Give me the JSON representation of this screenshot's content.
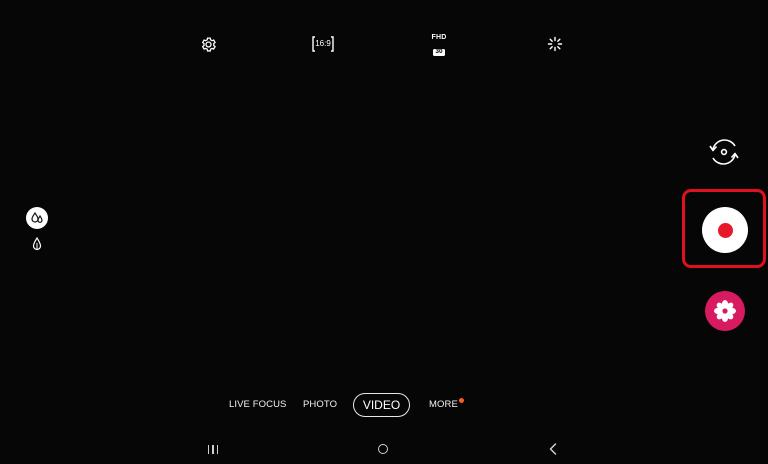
{
  "top_bar": {
    "settings_icon": "gear-icon",
    "aspect_ratio_label": "16:9",
    "resolution_label": "FHD",
    "framerate_label": "30",
    "effects_icon": "sparkle-icon"
  },
  "left_controls": {
    "beauty_icon": "water-drop-icon",
    "tone_icon": "drop-icon"
  },
  "right_controls": {
    "switch_camera_icon": "camera-switch-icon",
    "record_icon": "record-icon",
    "gallery_icon": "flower-icon",
    "highlight_color": "#e0101e",
    "record_color": "#e8182b",
    "gallery_color": "#d81b60"
  },
  "modes": {
    "items": [
      "LIVE FOCUS",
      "PHOTO",
      "VIDEO",
      "MORE"
    ],
    "selected": "VIDEO",
    "more_notification_color": "#ff5a1f"
  },
  "nav_bar": {
    "recent_icon": "recent-apps-icon",
    "home_icon": "home-icon",
    "back_icon": "back-icon"
  }
}
